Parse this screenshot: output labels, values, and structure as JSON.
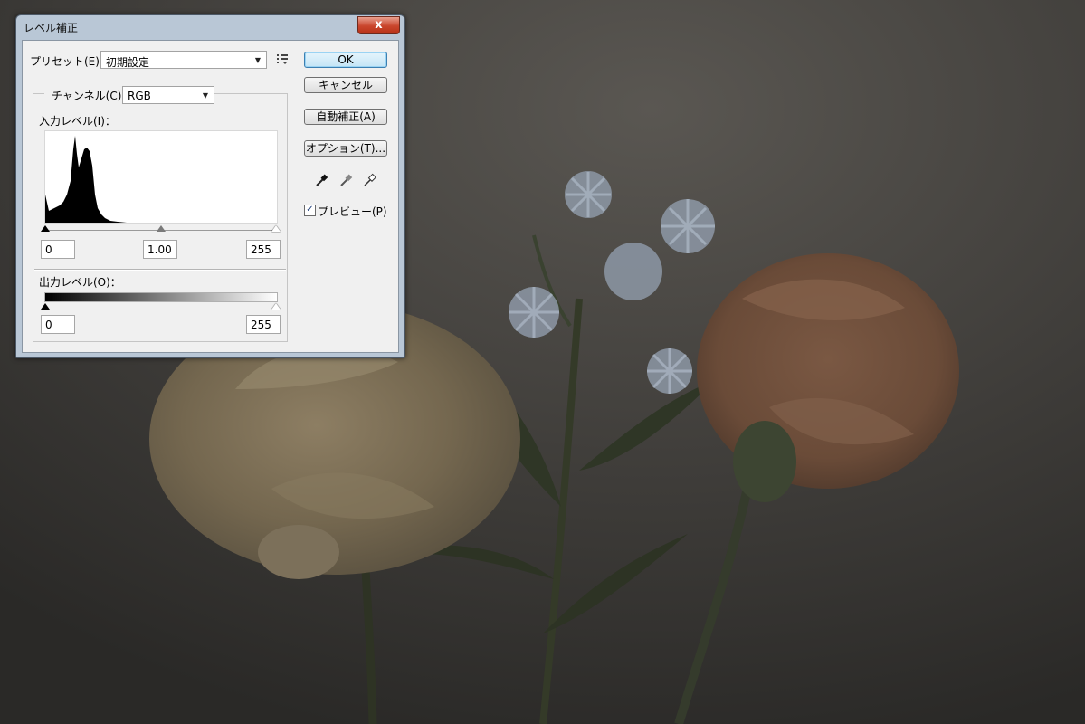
{
  "dialog": {
    "title": "レベル補正",
    "close_label": "x",
    "preset": {
      "label": "プリセット(E)：",
      "value": "初期設定"
    },
    "channel": {
      "label": "チャンネル(C)：",
      "value": "RGB"
    },
    "input_levels": {
      "label": "入力レベル(I)：",
      "black": "0",
      "gamma": "1.00",
      "white": "255"
    },
    "output_levels": {
      "label": "出力レベル(O)：",
      "black": "0",
      "white": "255"
    },
    "buttons": {
      "ok": "OK",
      "cancel": "キャンセル",
      "auto": "自動補正(A)",
      "options": "オプション(T)..."
    },
    "preview": {
      "label": "プレビュー(P)",
      "checked": true,
      "mark": "✓"
    },
    "icons": [
      "preset-menu-icon",
      "black-eyedropper-icon",
      "gray-eyedropper-icon",
      "white-eyedropper-icon",
      "dropdown-arrow-icon"
    ]
  },
  "colors": {
    "title_bar": "#b9c7d6",
    "close_button": "#c9452c",
    "ok_button_border": "#3c7fb1",
    "dialog_face": "#f0f0f0",
    "photo_background": "#3a3835"
  }
}
